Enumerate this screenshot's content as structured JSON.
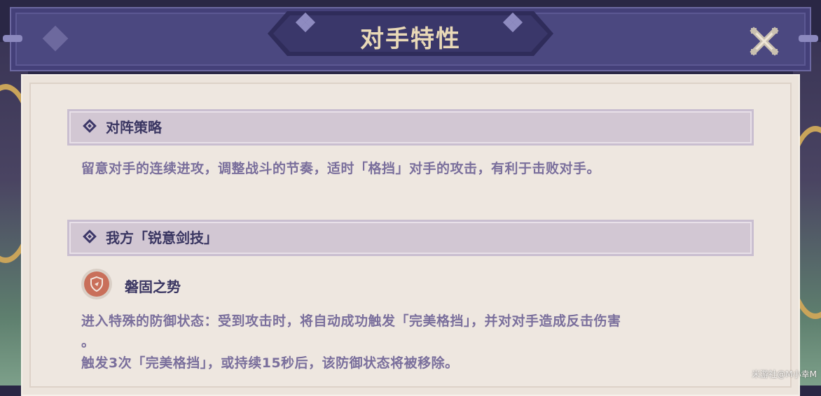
{
  "header": {
    "title": "对手特性",
    "close_icon": "close-x-icon"
  },
  "sections": [
    {
      "heading": "对阵策略",
      "text": "留意对手的连续进攻，调整战斗的节奏，适时「格挡」对手的攻击，有利于击败对手。"
    },
    {
      "heading": "我方「锐意剑技」",
      "skill": {
        "icon": "shield-counter-icon",
        "name": "磐固之势",
        "desc_lines": [
          "进入特殊的防御状态：受到攻击时，将自动成功触发「完美格挡」，并对对手造成反击伤害",
          "。",
          "触发3次「完美格挡」，或持续15秒后，该防御状态将被移除。"
        ]
      }
    }
  ],
  "watermark": "米游社@M小幸M",
  "colors": {
    "header_bg": "#4b4880",
    "title_text": "#e9d9b7",
    "panel_bg": "#eee7e0",
    "heading_bg": "#d2c7d3",
    "body_text": "#7a6f9c",
    "icon_accent": "#c96f5a"
  }
}
